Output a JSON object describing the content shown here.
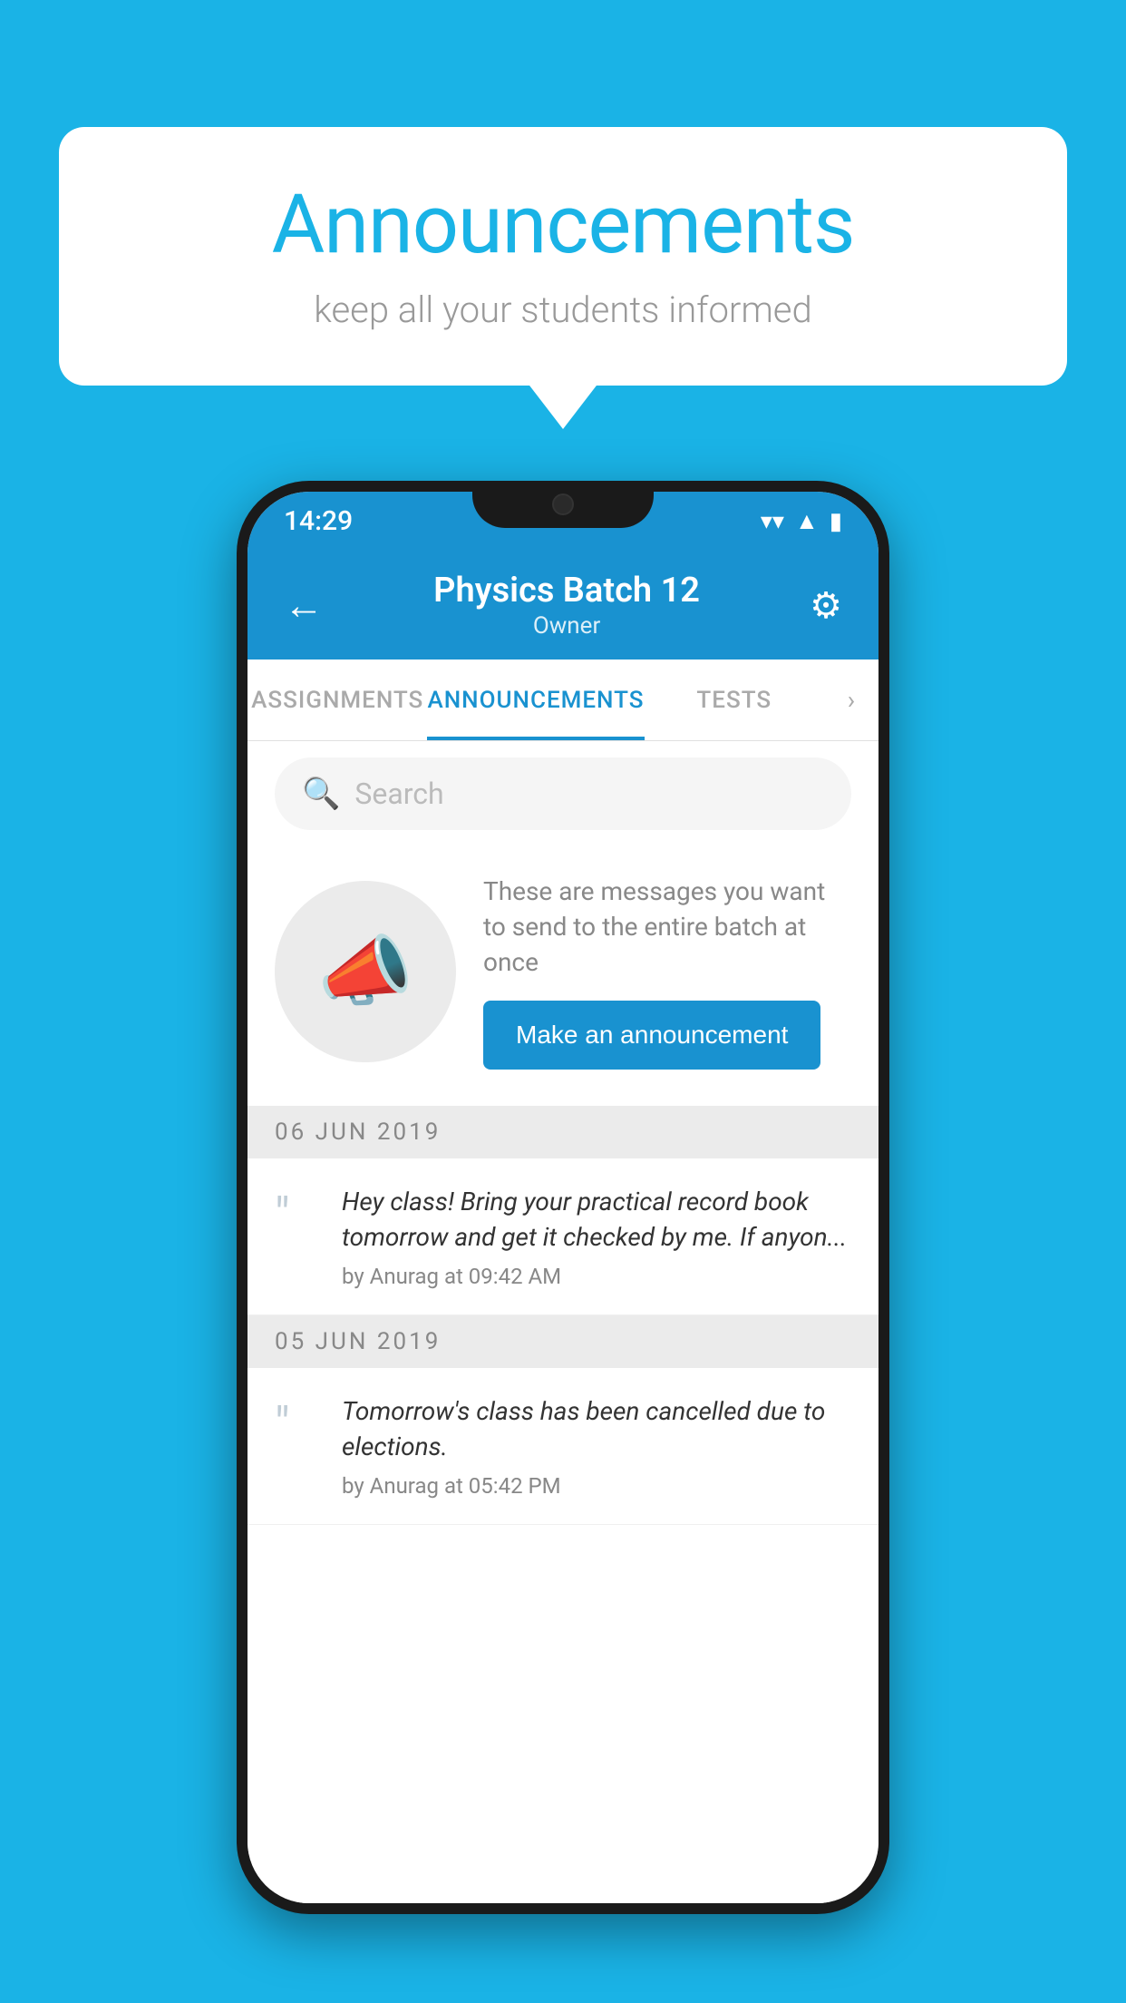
{
  "background_color": "#1ab3e6",
  "speech_bubble": {
    "title": "Announcements",
    "subtitle": "keep all your students informed"
  },
  "phone": {
    "status_bar": {
      "time": "14:29",
      "icons": [
        "wifi",
        "signal",
        "battery"
      ]
    },
    "header": {
      "back_label": "←",
      "title": "Physics Batch 12",
      "subtitle": "Owner",
      "settings_label": "⚙"
    },
    "tabs": [
      {
        "label": "ASSIGNMENTS",
        "active": false
      },
      {
        "label": "ANNOUNCEMENTS",
        "active": true
      },
      {
        "label": "TESTS",
        "active": false
      }
    ],
    "search": {
      "placeholder": "Search"
    },
    "promo": {
      "description": "These are messages you want to send to the entire batch at once",
      "button_label": "Make an announcement"
    },
    "announcements": [
      {
        "date": "06  JUN  2019",
        "text": "Hey class! Bring your practical record book tomorrow and get it checked by me. If anyon...",
        "author": "by Anurag at 09:42 AM"
      },
      {
        "date": "05  JUN  2019",
        "text": "Tomorrow's class has been cancelled due to elections.",
        "author": "by Anurag at 05:42 PM"
      }
    ]
  }
}
